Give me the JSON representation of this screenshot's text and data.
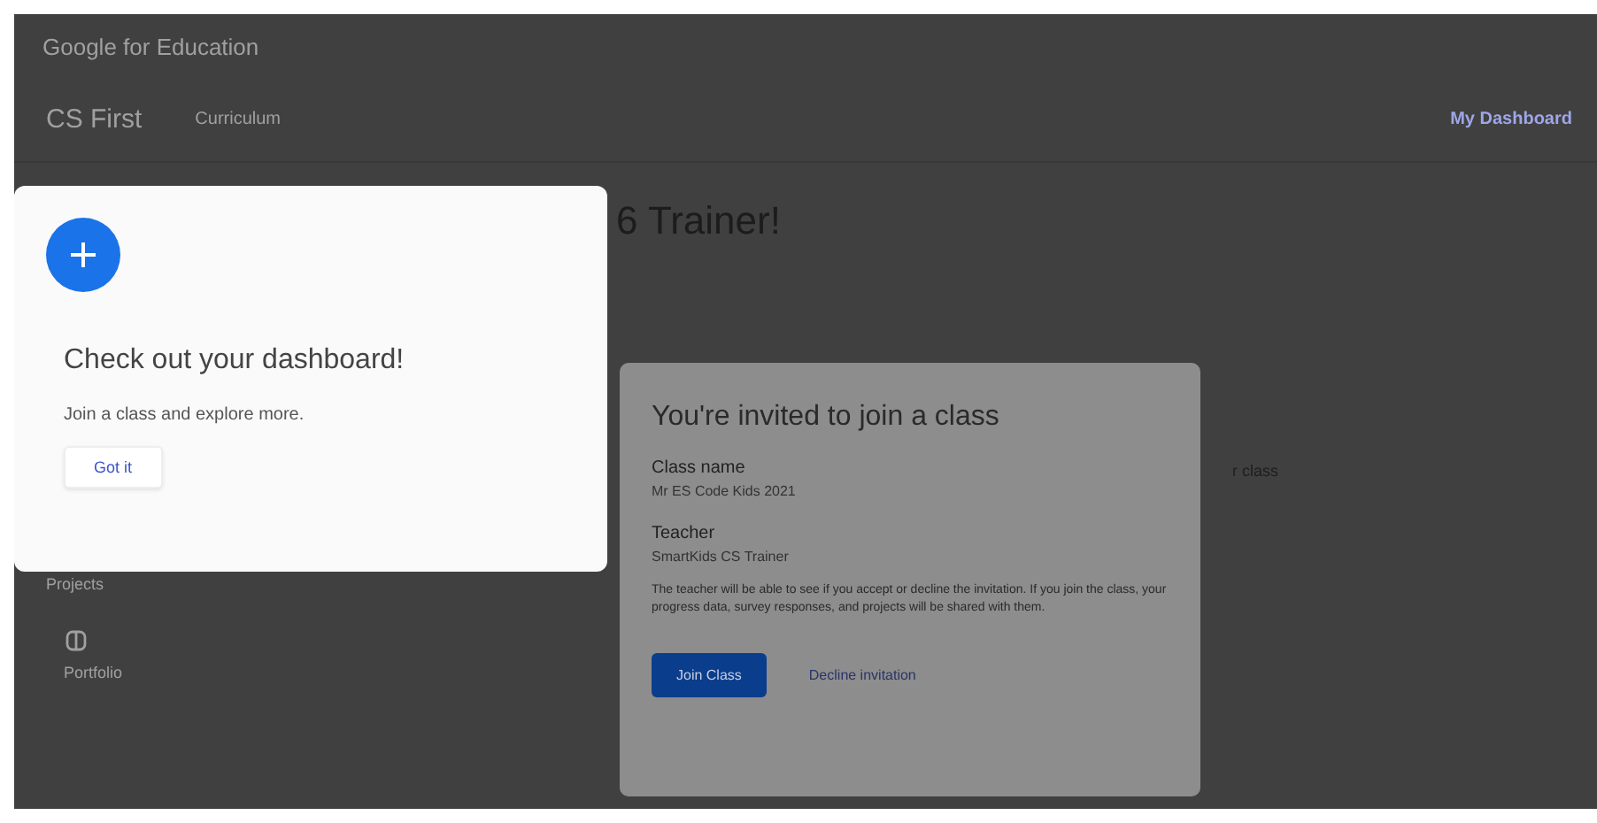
{
  "header": {
    "brand": "Google for Education"
  },
  "nav": {
    "site": "CS First",
    "links": [
      "Curriculum"
    ],
    "account": "My Dashboard"
  },
  "page": {
    "heading_fragment": "6 Trainer!",
    "class_fragment": "r class",
    "section_label": "Projects",
    "sidebar_item": "Portfolio"
  },
  "tip_card": {
    "title": "Check out your dashboard!",
    "text": "Join a class and explore more.",
    "button": "Got it"
  },
  "dialog": {
    "title": "You're invited to join a class",
    "fields": [
      {
        "label": "Class name",
        "value": "Mr ES Code Kids 2021"
      },
      {
        "label": "Teacher",
        "value": "SmartKids CS Trainer"
      }
    ],
    "notice": "The teacher will be able to see if you accept or decline the invitation. If you join the class, your progress data, survey responses, and projects will be shared with them.",
    "primary_button": "Join Class",
    "secondary_button": "Decline invitation"
  }
}
